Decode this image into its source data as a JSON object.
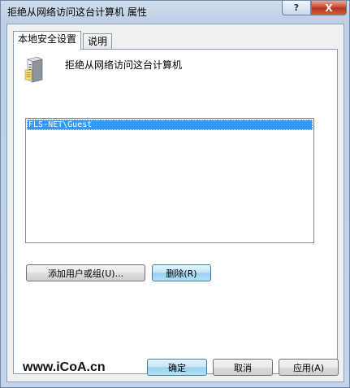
{
  "window": {
    "title": "拒绝从网络访问这台计算机 属性",
    "help_glyph": "?",
    "close_glyph": "X"
  },
  "tabs": [
    {
      "label": "本地安全设置"
    },
    {
      "label": "说明"
    }
  ],
  "policy": {
    "name": "拒绝从网络访问这台计算机",
    "icon": "server-icon"
  },
  "accounts": {
    "items": [
      "FLS-NET\\Guest"
    ],
    "selected_index": 0
  },
  "list_buttons": {
    "add": "添加用户或组(U)...",
    "remove": "删除(R)"
  },
  "dialog_buttons": {
    "ok": "确定",
    "cancel": "取消",
    "apply": "应用(A)"
  },
  "watermark": "www.iCoA.cn",
  "colors": {
    "selection": "#3399ff",
    "close_button": "#c9452c",
    "title_bar": "#bfd0e6"
  }
}
